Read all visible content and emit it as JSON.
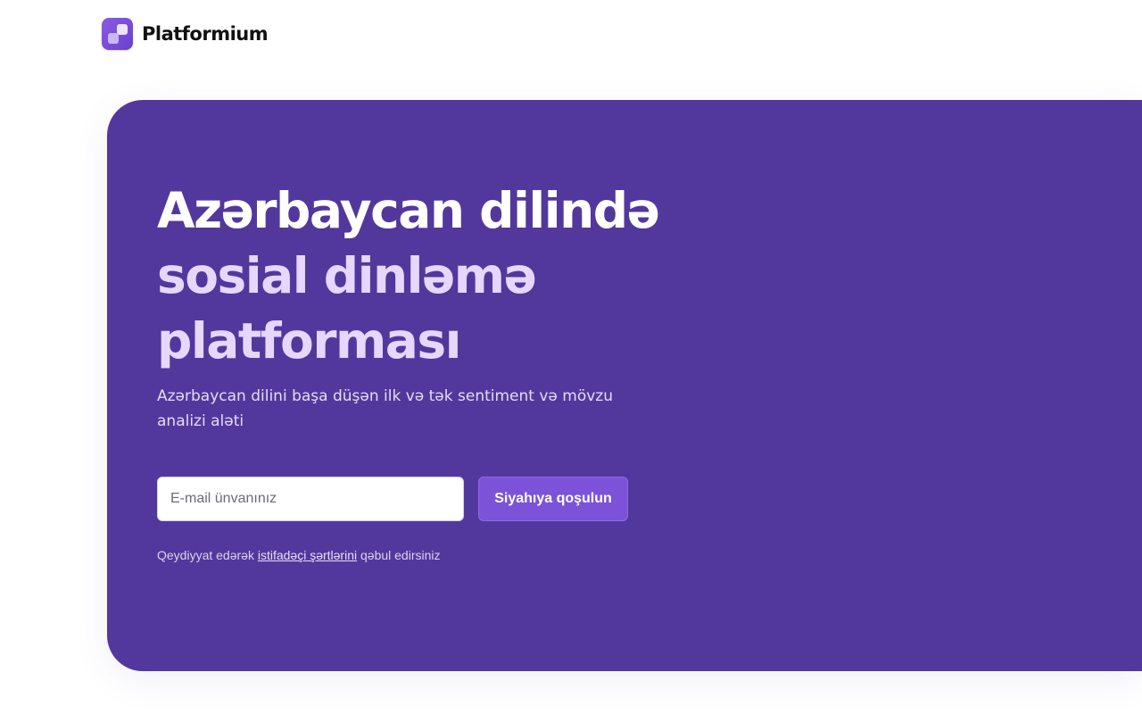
{
  "header": {
    "logo_icon": "platformium-logo-icon",
    "brand_name": "Platformium"
  },
  "hero": {
    "background": "#52389c",
    "headline_line1": "Azərbaycan dilində",
    "headline_line2": "sosial dinləmə platforması",
    "subtitle": "Azərbaycan dilini başa düşən ilk və tək sentiment və mövzu analizi aləti",
    "email_placeholder": "E-mail ünvanınız",
    "email_value": "",
    "join_button_label": "Siyahıya qoşulun",
    "terms_prefix": "Qeydiyyat edərək",
    "terms_link": "istifadəçi şərtlərini",
    "terms_suffix": "qəbul edirsiniz"
  },
  "colors": {
    "accent": "#7c52d9",
    "headline_highlight": "#e8d6ff"
  }
}
